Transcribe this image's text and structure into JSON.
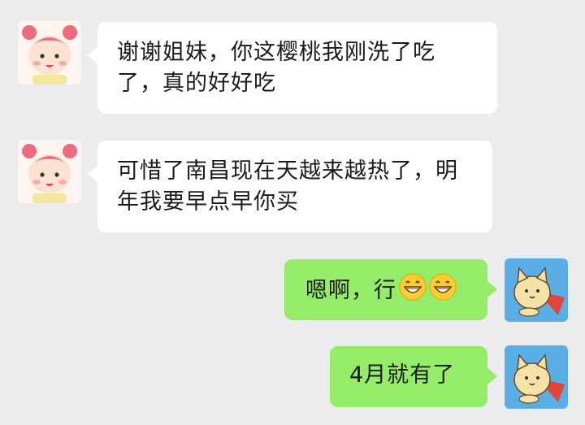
{
  "chat": {
    "messages": [
      {
        "side": "incoming",
        "text": "谢谢姐妹，你这樱桃我刚洗了吃了，真的好好吃",
        "avatar": "cartoon-girl-pink-hair"
      },
      {
        "side": "incoming",
        "text": "可惜了南昌现在天越来越热了，明年我要早点早你买",
        "avatar": "cartoon-girl-pink-hair"
      },
      {
        "side": "outgoing",
        "text": "嗯啊，行",
        "emoji": [
          "grinning-face-emoji",
          "grinning-face-emoji"
        ],
        "avatar": "cartoon-cat-caped"
      },
      {
        "side": "outgoing",
        "text": "4月就有了",
        "avatar": "cartoon-cat-caped"
      }
    ]
  },
  "colors": {
    "background": "#ececec",
    "incoming_bubble": "#ffffff",
    "outgoing_bubble": "#95ec69",
    "text": "#1a1a1a"
  }
}
